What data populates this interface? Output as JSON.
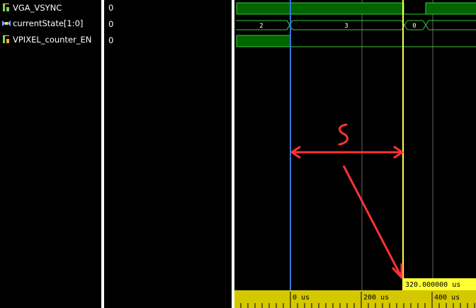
{
  "signals": [
    {
      "name": "VGA_VSYNC",
      "value": "0",
      "icon": "single-bit-signal-icon"
    },
    {
      "name": "currentState[1:0]",
      "value": "0",
      "icon": "bus-signal-icon"
    },
    {
      "name": "VPIXEL_counter_EN",
      "value": "0",
      "icon": "single-bit-signal-icon"
    }
  ],
  "bus_segments": [
    "2",
    "3",
    "0"
  ],
  "cursor_readout": "320.000000 us",
  "time_ticks": [
    "0 us",
    "200 us",
    "400 us"
  ],
  "annotation": {
    "label": "S"
  },
  "colors": {
    "waveform_high": "#006600",
    "waveform_line": "#33cc33",
    "cursor_blue": "#3377dd",
    "cursor_yellow": "#ffff55",
    "ruler": "#d4c800",
    "annotation": "#ff3333"
  }
}
